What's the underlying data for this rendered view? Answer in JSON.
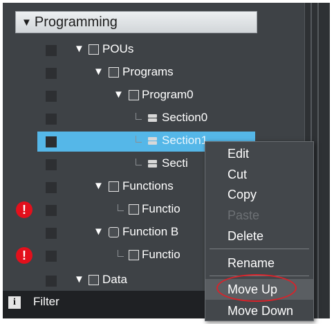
{
  "section": {
    "title": "Programming"
  },
  "tree": [
    {
      "label": "POUs",
      "icon": "pou-icon",
      "kind": "folder"
    },
    {
      "label": "Programs",
      "icon": "programs-icon",
      "kind": "folder"
    },
    {
      "label": "Program0",
      "icon": "program-icon",
      "kind": "folder"
    },
    {
      "label": "Section0",
      "icon": "section-icon",
      "kind": "leaf"
    },
    {
      "label": "Section1",
      "icon": "section-icon",
      "kind": "leaf",
      "selected": true
    },
    {
      "label": "Secti",
      "icon": "section-icon",
      "kind": "leaf"
    },
    {
      "label": "Functions",
      "icon": "functions-icon",
      "kind": "folder"
    },
    {
      "label": "Functio",
      "icon": "function-icon",
      "kind": "leaf",
      "error": true
    },
    {
      "label": "Function B",
      "icon": "function-blocks-icon",
      "kind": "folder"
    },
    {
      "label": "Functio",
      "icon": "function-block-icon",
      "kind": "leaf",
      "error": true
    },
    {
      "label": "Data",
      "icon": "data-icon",
      "kind": "folder"
    }
  ],
  "filter": {
    "label": "Filter",
    "icon": "info-icon"
  },
  "context_menu": {
    "items": [
      {
        "label": "Edit",
        "enabled": true
      },
      {
        "label": "Cut",
        "enabled": true
      },
      {
        "label": "Copy",
        "enabled": true
      },
      {
        "label": "Paste",
        "enabled": false
      },
      {
        "label": "Delete",
        "enabled": true
      },
      {
        "label": "Rename",
        "enabled": true
      },
      {
        "label": "Move Up",
        "enabled": true,
        "highlighted": true
      },
      {
        "label": "Move Down",
        "enabled": true
      }
    ]
  },
  "colors": {
    "panel": "#3e4246",
    "selection": "#55b7e8",
    "error": "#e3101c",
    "annotation": "#d8232a"
  }
}
